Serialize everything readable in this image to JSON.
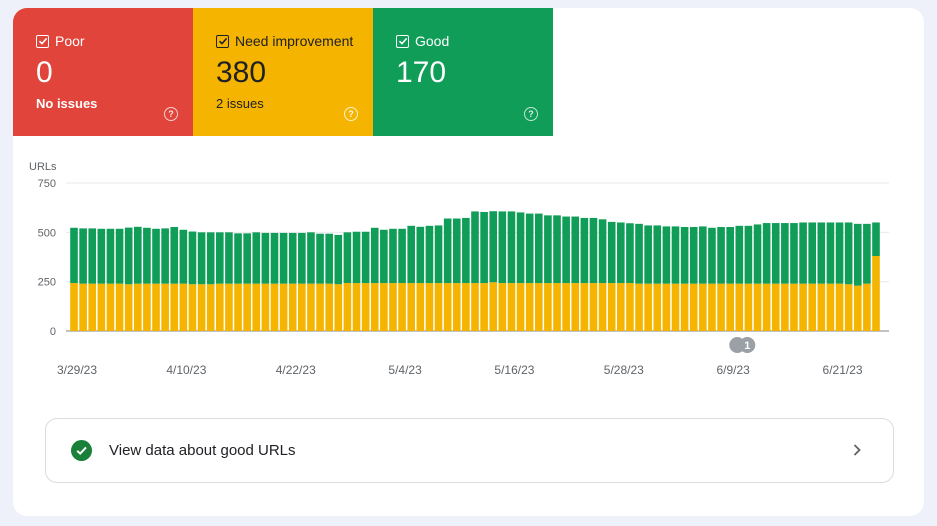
{
  "tiles": [
    {
      "key": "poor",
      "label": "Poor",
      "value": "0",
      "sub": "No issues",
      "color": "#e0443a"
    },
    {
      "key": "ni",
      "label": "Need improvement",
      "value": "380",
      "sub": "2 issues",
      "color": "#f4b400"
    },
    {
      "key": "good",
      "label": "Good",
      "value": "170",
      "sub": "",
      "color": "#0f9d58"
    }
  ],
  "help_glyph": "?",
  "chart_data": {
    "type": "bar",
    "stacked": true,
    "ylabel": "URLs",
    "ylim": [
      0,
      750
    ],
    "yticks": [
      "0",
      "250",
      "500",
      "750"
    ],
    "xtick_labels": [
      "3/29/23",
      "4/10/23",
      "4/22/23",
      "5/4/23",
      "5/16/23",
      "5/28/23",
      "6/9/23",
      "6/21/23"
    ],
    "annotation": {
      "label": "1",
      "date": "6/10/23"
    },
    "series": [
      {
        "name": "Need improvement",
        "color": "#f4b400",
        "values": [
          243,
          240,
          240,
          240,
          240,
          240,
          237,
          240,
          240,
          240,
          240,
          240,
          240,
          237,
          237,
          237,
          240,
          240,
          240,
          240,
          240,
          240,
          240,
          240,
          240,
          240,
          240,
          240,
          240,
          237,
          243,
          243,
          243,
          243,
          243,
          243,
          243,
          243,
          243,
          243,
          243,
          243,
          243,
          243,
          243,
          243,
          247,
          243,
          243,
          243,
          243,
          243,
          243,
          243,
          243,
          243,
          243,
          243,
          243,
          243,
          243,
          243,
          240,
          240,
          240,
          240,
          240,
          240,
          240,
          240,
          240,
          240,
          240,
          240,
          240,
          240,
          240,
          240,
          240,
          240,
          240,
          240,
          240,
          240,
          240,
          237,
          230,
          240,
          380
        ]
      },
      {
        "name": "Good",
        "color": "#0f9d58",
        "values": [
          280,
          280,
          280,
          278,
          278,
          278,
          287,
          288,
          283,
          278,
          280,
          287,
          273,
          267,
          263,
          263,
          260,
          260,
          255,
          255,
          260,
          257,
          257,
          257,
          257,
          257,
          260,
          253,
          253,
          250,
          257,
          260,
          260,
          280,
          270,
          275,
          275,
          290,
          285,
          290,
          292,
          327,
          327,
          330,
          363,
          360,
          360,
          363,
          363,
          358,
          352,
          352,
          343,
          343,
          337,
          337,
          330,
          330,
          323,
          310,
          307,
          303,
          303,
          295,
          295,
          290,
          290,
          287,
          287,
          290,
          283,
          287,
          287,
          293,
          293,
          300,
          307,
          307,
          307,
          307,
          310,
          310,
          310,
          310,
          310,
          313,
          313,
          303,
          170
        ]
      }
    ]
  },
  "link": {
    "label": "View data about good URLs"
  }
}
